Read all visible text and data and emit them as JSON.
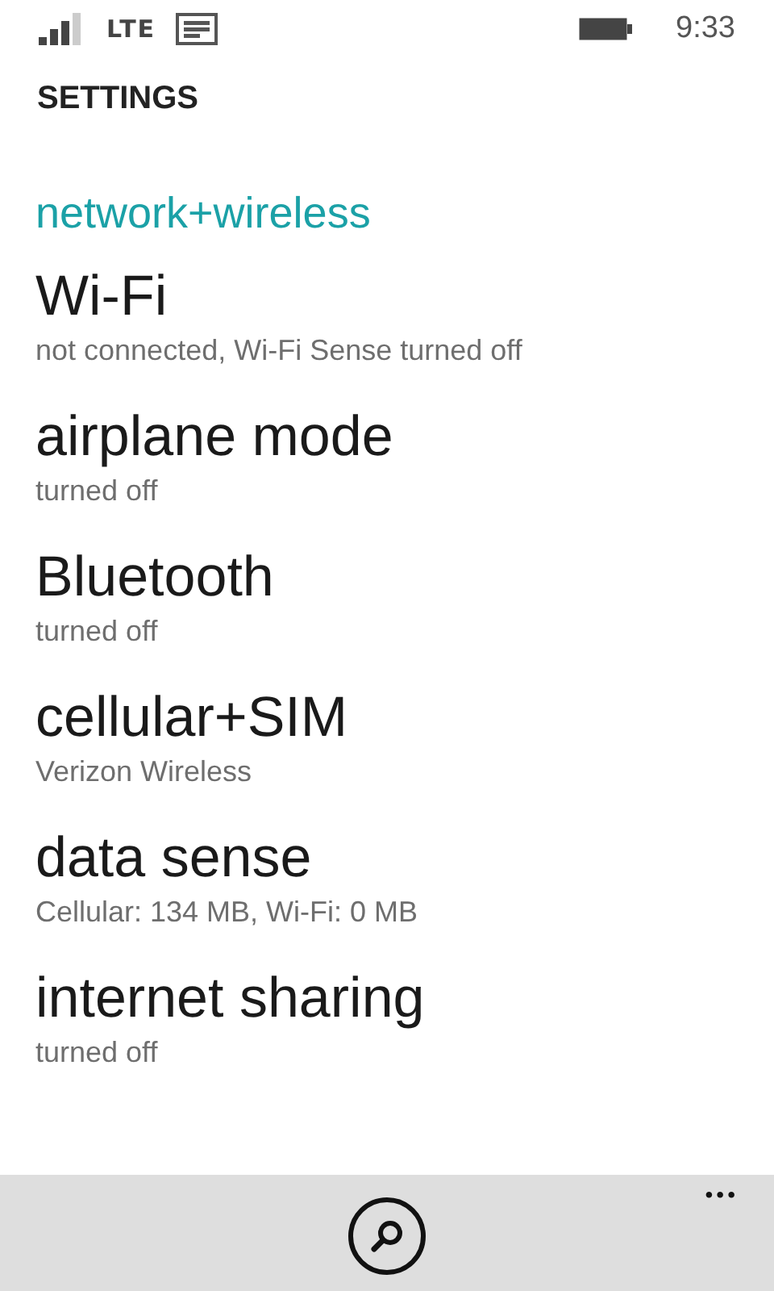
{
  "status_bar": {
    "network": "LTE",
    "time": "9:33"
  },
  "page_title": "SETTINGS",
  "section": {
    "title": "network+wireless"
  },
  "items": [
    {
      "title": "Wi-Fi",
      "subtitle": "not connected, Wi-Fi Sense turned off"
    },
    {
      "title": "airplane mode",
      "subtitle": "turned off"
    },
    {
      "title": "Bluetooth",
      "subtitle": "turned off"
    },
    {
      "title": "cellular+SIM",
      "subtitle": "Verizon Wireless"
    },
    {
      "title": "data sense",
      "subtitle": "Cellular: 134 MB, Wi-Fi: 0 MB"
    },
    {
      "title": "internet sharing",
      "subtitle": "turned off"
    }
  ],
  "app_bar": {
    "more": "•••"
  }
}
